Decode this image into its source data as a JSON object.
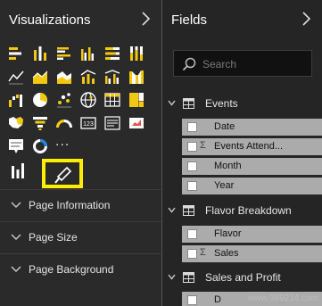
{
  "visualizations": {
    "title": "Visualizations",
    "chevron_icon": "chevron-right-icon",
    "icons": [
      "stacked-bar-chart-icon",
      "stacked-column-chart-icon",
      "clustered-bar-chart-icon",
      "clustered-column-chart-icon",
      "100-percent-bar-chart-icon",
      "100-percent-column-chart-icon",
      "line-chart-icon",
      "area-chart-icon",
      "stacked-area-chart-icon",
      "line-column-chart-icon",
      "line-clustered-column-chart-icon",
      "ribbon-chart-icon",
      "waterfall-chart-icon",
      "pie-chart-icon",
      "scatter-chart-icon",
      "map-icon",
      "table-icon",
      "treemap-icon",
      "filled-map-icon",
      "funnel-icon",
      "gauge-icon",
      "card-icon",
      "kpi-icon",
      "multi-row-card-icon",
      "slicer-icon",
      "donut-chart-icon",
      "more-visuals-icon"
    ],
    "more_label": "...",
    "tabs": {
      "fields_icon": "fields-tab-icon",
      "format_icon": "paint-roller-icon"
    },
    "sections": [
      {
        "label": "Page Information"
      },
      {
        "label": "Page Size"
      },
      {
        "label": "Page Background"
      }
    ]
  },
  "fields": {
    "title": "Fields",
    "chevron_icon": "chevron-right-icon",
    "search_placeholder": "Search",
    "tables": [
      {
        "name": "Events",
        "fields": [
          {
            "label": "Date",
            "sigma": false
          },
          {
            "label": "Events Attend...",
            "sigma": true
          },
          {
            "label": "Month",
            "sigma": false
          },
          {
            "label": "Year",
            "sigma": false
          }
        ]
      },
      {
        "name": "Flavor Breakdown",
        "fields": [
          {
            "label": "Flavor",
            "sigma": false
          },
          {
            "label": "Sales",
            "sigma": true
          }
        ]
      },
      {
        "name": "Sales and Profit",
        "fields": [
          {
            "label": "D",
            "sigma": false
          }
        ]
      }
    ],
    "sigma_symbol": "Σ"
  },
  "watermark": "www.989214.com",
  "colors": {
    "highlight": "#ffed00",
    "field_row_bg": "#ababab",
    "pane_bg": "#2a2a2a"
  }
}
